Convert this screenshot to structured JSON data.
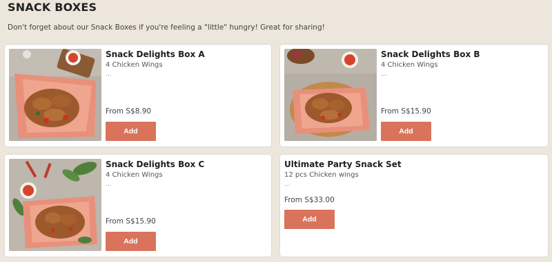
{
  "section": {
    "title": "SNACK BOXES",
    "description": "Don't forget about our Snack Boxes if you're feeling a \"little\" hungry! Great for sharing!"
  },
  "products": [
    {
      "name": "Snack Delights Box A",
      "subtitle": "4 Chicken Wings",
      "more": "...",
      "price": "From S$8.90",
      "button": "Add",
      "image": "snack-box-a-photo"
    },
    {
      "name": "Snack Delights Box B",
      "subtitle": "4 Chicken Wings",
      "more": "...",
      "price": "From S$15.90",
      "button": "Add",
      "image": "snack-box-b-photo"
    },
    {
      "name": "Snack Delights Box C",
      "subtitle": "4 Chicken Wings",
      "more": "...",
      "price": "From S$15.90",
      "button": "Add",
      "image": "snack-box-c-photo"
    },
    {
      "name": "Ultimate Party Snack Set",
      "subtitle": "12 pcs Chicken wings",
      "more": "...",
      "price": "From S$33.00",
      "button": "Add"
    }
  ],
  "colors": {
    "background": "#ece6dc",
    "card": "#ffffff",
    "accent_button": "#d9735b"
  }
}
